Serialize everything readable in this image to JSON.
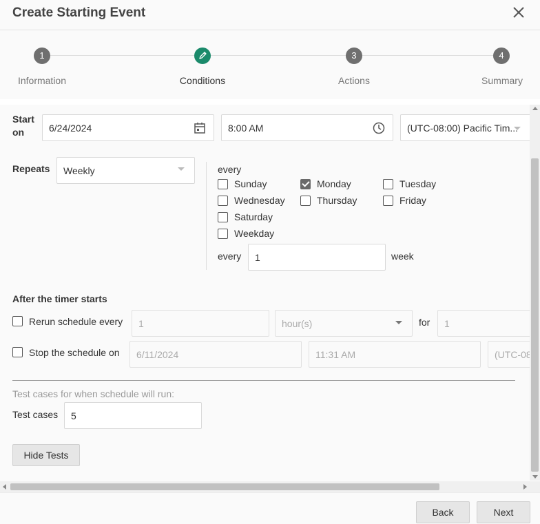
{
  "dialog": {
    "title": "Create Starting Event"
  },
  "stepper": {
    "steps": [
      {
        "number": "1",
        "label": "Information"
      },
      {
        "number": "",
        "label": "Conditions"
      },
      {
        "number": "3",
        "label": "Actions"
      },
      {
        "number": "4",
        "label": "Summary"
      }
    ],
    "active_color": "#1b8a6b"
  },
  "start": {
    "label_line1": "Start",
    "label_line2": "on",
    "date": "6/24/2024",
    "time": "8:00 AM",
    "timezone": "(UTC-08:00) Pacific Tim..."
  },
  "repeats": {
    "label": "Repeats",
    "value": "Weekly",
    "every_label": "every",
    "days": [
      {
        "label": "Sunday",
        "checked": false
      },
      {
        "label": "Monday",
        "checked": true
      },
      {
        "label": "Tuesday",
        "checked": false
      },
      {
        "label": "Wednesday",
        "checked": false
      },
      {
        "label": "Thursday",
        "checked": false
      },
      {
        "label": "Friday",
        "checked": false
      },
      {
        "label": "Saturday",
        "checked": false
      },
      {
        "label": "Weekday",
        "checked": false
      }
    ],
    "interval_prefix": "every",
    "interval_value": "1",
    "interval_suffix": "week"
  },
  "after_timer": {
    "heading": "After the timer starts",
    "rerun_label": "Rerun schedule every",
    "rerun_value": "1",
    "rerun_unit": "hour(s)",
    "for_label": "for",
    "for_value": "1",
    "stop_label": "Stop the schedule on",
    "stop_date": "6/11/2024",
    "stop_time": "11:31 AM",
    "stop_timezone": "(UTC-08"
  },
  "tests": {
    "description": "Test cases for when schedule will run:",
    "label": "Test cases",
    "value": "5",
    "hide_button": "Hide Tests"
  },
  "footer": {
    "back": "Back",
    "next": "Next"
  }
}
